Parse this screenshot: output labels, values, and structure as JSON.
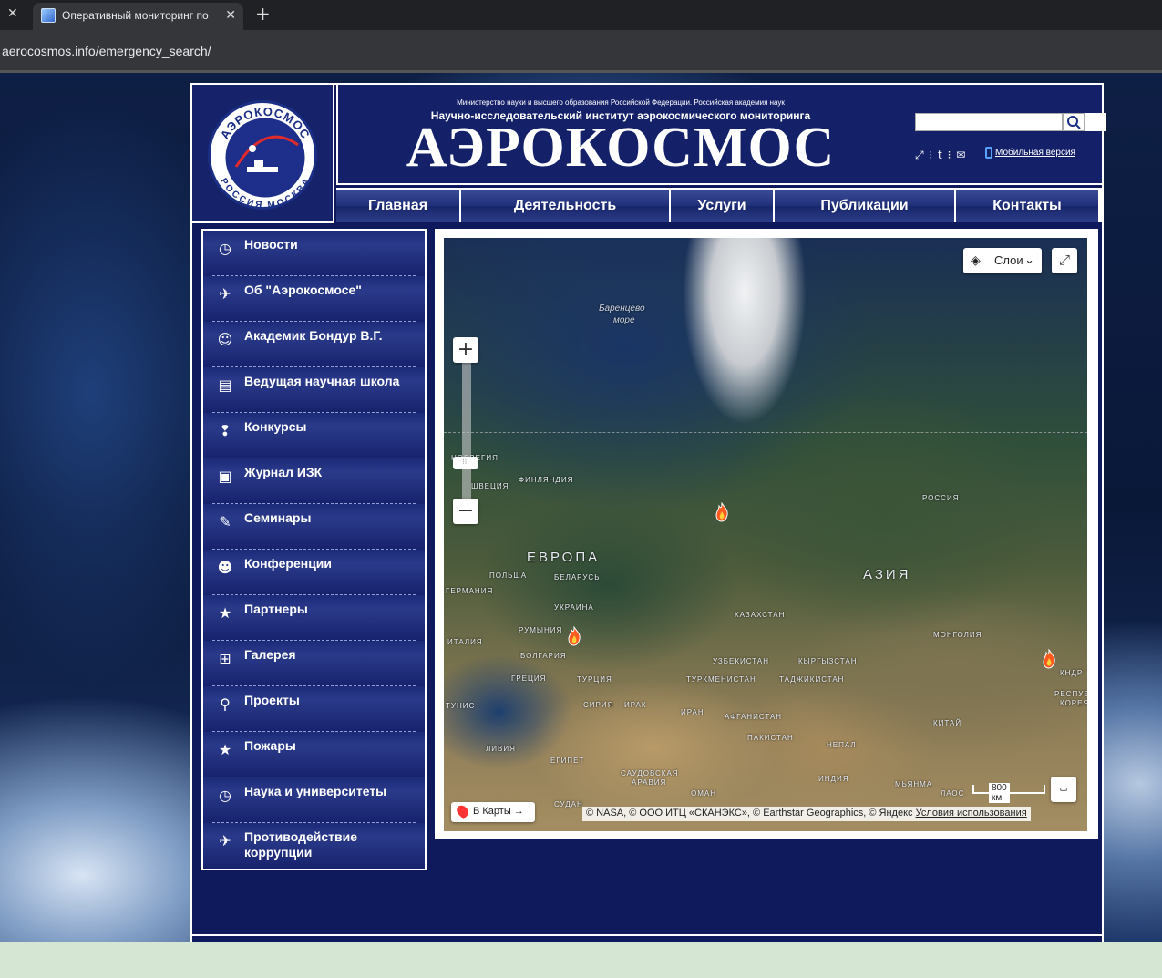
{
  "browser": {
    "tab_title": "Оперативный мониторинг по",
    "url": "aerocosmos.info/emergency_search/",
    "new_tab": "+",
    "close": "✕"
  },
  "header": {
    "ministry": "Министерство науки и высшего образования Российской Федерации. Российская академия наук",
    "institute": "Научно-исследовательский институт аэрокосмического мониторинга",
    "title": "АЭРОКОСМОС",
    "search_placeholder": "",
    "social_icons": [
      "rss-icon",
      "twitter-icon",
      "mail-icon"
    ],
    "social_glyphs": "⤢ ⁝ t ⁝ ✉",
    "mobile_link": "Мобильная версия",
    "logo_text_top": "АЭРОКОСМОС",
    "logo_text_bottom": "РОССИЯ МОСКВА"
  },
  "nav": [
    {
      "label": "Главная"
    },
    {
      "label": "Деятельность"
    },
    {
      "label": "Услуги"
    },
    {
      "label": "Публикации"
    },
    {
      "label": "Контакты"
    }
  ],
  "sidebar": [
    {
      "label": "Новости",
      "icon": "clock-icon",
      "glyph": "◷"
    },
    {
      "label": "Об \"Аэрокосмосе\"",
      "icon": "satellite-icon",
      "glyph": "✈"
    },
    {
      "label": "Академик Бондур В.Г.",
      "icon": "user-add-icon",
      "glyph": "☺"
    },
    {
      "label": "Ведущая научная школа",
      "icon": "document-icon",
      "glyph": "▤"
    },
    {
      "label": "Конкурсы",
      "icon": "chat-alert-icon",
      "glyph": "❢"
    },
    {
      "label": "Журнал ИЗК",
      "icon": "journal-icon",
      "glyph": "▣"
    },
    {
      "label": "Семинары",
      "icon": "pen-icon",
      "glyph": "✎"
    },
    {
      "label": "Конференции",
      "icon": "group-icon",
      "glyph": "☻"
    },
    {
      "label": "Партнеры",
      "icon": "star-icon",
      "glyph": "★"
    },
    {
      "label": "Галерея",
      "icon": "sitemap-icon",
      "glyph": "⊞"
    },
    {
      "label": "Проекты",
      "icon": "search-icon",
      "glyph": "⚲"
    },
    {
      "label": "Пожары",
      "icon": "star-icon",
      "glyph": "★"
    },
    {
      "label": "Наука и университеты",
      "icon": "clock-icon",
      "glyph": "◷"
    },
    {
      "label": "Противодействие коррупции",
      "icon": "satellite-icon",
      "glyph": "✈"
    }
  ],
  "map": {
    "layers_label": "Слои",
    "zoom_in": "+",
    "zoom_out": "−",
    "zoom_thumb": "⁝⁝⁝",
    "fullscreen": "⤢",
    "ruler": "▭",
    "open_in_maps": "В Карты →",
    "scale": "800 км",
    "copyright_text": "© NASA, © ООО ИТЦ «СКАНЭКС», © Earthstar Geographics, © Яндекс ",
    "terms_link": "Условия использования",
    "labels": {
      "barents_sea_1": "Баренцево",
      "barents_sea_2": "море",
      "norway": "НОРВЕГИЯ",
      "sweden": "ШВЕЦИЯ",
      "finland": "ФИНЛЯНДИЯ",
      "russia": "РОССИЯ",
      "europe": "ЕВРОПА",
      "asia": "АЗИЯ",
      "poland": "ПОЛЬША",
      "belarus": "БЕЛАРУСЬ",
      "germany": "ГЕРМАНИЯ",
      "ukraine": "УКРАИНА",
      "kazakhstan": "КАЗАХСТАН",
      "romania": "РУМЫНИЯ",
      "mongolia": "МОНГОЛИЯ",
      "italy": "ИТАЛИЯ",
      "bulgaria": "БОЛГАРИЯ",
      "uzbekistan": "УЗБЕКИСТАН",
      "kyrgyzstan": "КЫРГЫЗСТАН",
      "dprk": "КНДР",
      "greece": "ГРЕЦИЯ",
      "turkey": "ТУРЦИЯ",
      "turkmenistan": "ТУРКМЕНИСТАН",
      "tajikistan": "ТАДЖИКИСТАН",
      "korea_1": "РЕСПУБЛИ",
      "korea_2": "КОРЕЯ",
      "tunisia": "ТУНИС",
      "syria": "СИРИЯ",
      "iraq": "ИРАК",
      "iran": "ИРАН",
      "afghanistan": "АФГАНИСТАН",
      "china": "КИТАЙ",
      "libya": "ЛИВИЯ",
      "pakistan": "ПАКИСТАН",
      "nepal": "НЕПАЛ",
      "egypt": "ЕГИПЕТ",
      "saudi_1": "САУДОВСКАЯ",
      "saudi_2": "АРАВИЯ",
      "india": "ИНДИЯ",
      "oman": "ОМАН",
      "myanmar": "МЬЯНМА",
      "laos": "ЛАОС",
      "sudan": "СУДАН"
    },
    "fires_count": 3
  }
}
